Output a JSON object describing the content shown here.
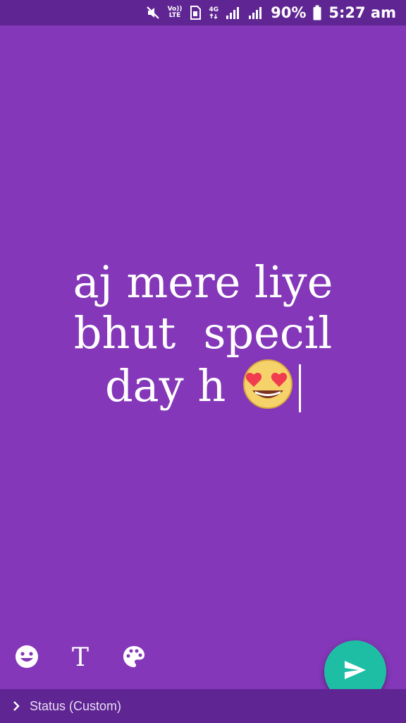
{
  "status_bar": {
    "volte_top": "Vo))",
    "volte_bottom": "LTE",
    "network_type": "4G",
    "battery_percent": "90%",
    "time": "5:27 am"
  },
  "status_post": {
    "lines": [
      "aj mere liye",
      "bhut  specil",
      "day h"
    ],
    "emoji": "smiling-face-with-heart-eyes"
  },
  "toolbar": {
    "text_tool_label": "T"
  },
  "footer": {
    "audience_label": "Status (Custom)"
  },
  "colors": {
    "background": "#8437b8",
    "bars": "#5f2592",
    "send_button": "#1ebea5",
    "text": "#ffffff"
  }
}
